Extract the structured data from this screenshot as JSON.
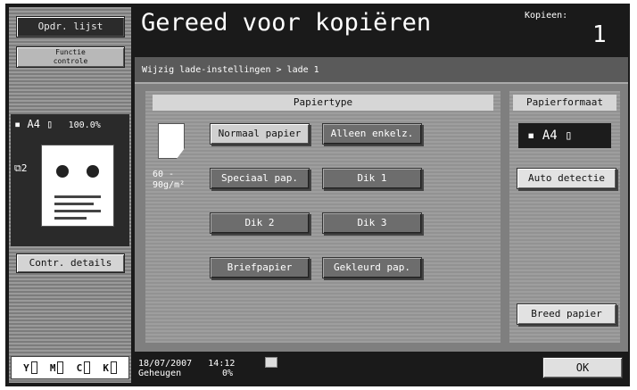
{
  "left_panel": {
    "job_list_label": "Opdr. lijst",
    "check_function_label": "Functie\ncontrole",
    "paper_status": "A4",
    "zoom": "100.0%",
    "tray_number": "2",
    "check_details_label": "Contr. details",
    "toner": [
      "Y",
      "M",
      "C",
      "K"
    ]
  },
  "header": {
    "title": "Gereed voor kopiëren",
    "copies_label": "Kopieen:",
    "copies_value": "1"
  },
  "breadcrumb": "Wijzig lade-instellingen > lade 1",
  "paper_type": {
    "heading": "Papiertype",
    "weight": "60 -\n90g/m²",
    "selected": "Normaal papier",
    "buttons": [
      "Normaal papier",
      "Alleen enkelz.",
      "Speciaal pap.",
      "Dik 1",
      "Dik 2",
      "Dik 3",
      "Briefpapier",
      "Gekleurd pap."
    ]
  },
  "paper_format": {
    "heading": "Papierformaat",
    "current": "A4",
    "auto_detect_label": "Auto detectie",
    "wide_paper_label": "Breed papier"
  },
  "footer": {
    "date": "18/07/2007",
    "time": "14:12",
    "memory_label": "Geheugen",
    "memory_value": "0%",
    "ok_label": "OK"
  }
}
